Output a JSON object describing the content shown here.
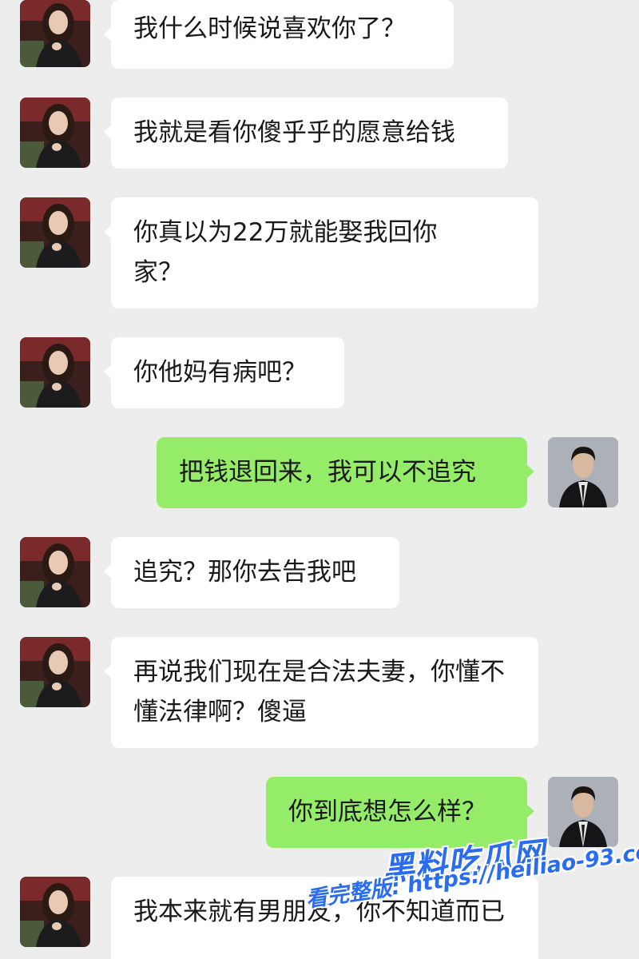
{
  "chat": {
    "messages": [
      {
        "side": "in",
        "text": "我什么时候说喜欢你了？"
      },
      {
        "side": "in",
        "text": "我就是看你傻乎乎的愿意给钱"
      },
      {
        "side": "in",
        "text": "你真以为22万就能娶我回你家？"
      },
      {
        "side": "in",
        "text": "你他妈有病吧？"
      },
      {
        "side": "out",
        "text": "把钱退回来，我可以不追究"
      },
      {
        "side": "in",
        "text": "追究？那你去告我吧"
      },
      {
        "side": "in",
        "text": "再说我们现在是合法夫妻，你懂不懂法律啊？傻逼"
      },
      {
        "side": "out",
        "text": "你到底想怎么样？"
      },
      {
        "side": "in",
        "text": "我本来就有男朋友，你不知道而已"
      }
    ]
  },
  "watermark": {
    "brand": "黑料吃瓜网",
    "line": "看完整版: https://heiliao-93.com"
  },
  "colors": {
    "background": "#ededed",
    "incoming_bubble": "#ffffff",
    "outgoing_bubble": "#95ec69",
    "watermark": "#2a6cf0"
  },
  "icons": {
    "incoming_avatar": "woman-portrait-avatar",
    "outgoing_avatar": "man-in-suit-avatar"
  }
}
